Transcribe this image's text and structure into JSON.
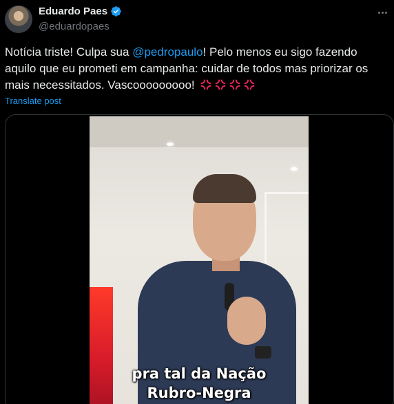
{
  "author": {
    "display_name": "Eduardo Paes",
    "handle": "@eduardopaes",
    "verified": true
  },
  "tweet": {
    "text_before_mention": "Notícia triste!  Culpa sua ",
    "mention": "@pedropaulo",
    "text_after_mention": "!  Pelo menos eu sigo fazendo aquilo que eu prometi em campanha: cuidar de todos mas priorizar os mais necessitados. Vascooooooooo! ",
    "emojis": [
      "anger-symbol",
      "anger-symbol",
      "anger-symbol",
      "anger-symbol"
    ]
  },
  "translate_link": "Translate post",
  "media": {
    "caption_line1": "pra tal da Nação",
    "caption_line2": "Rubro-Negra"
  },
  "colors": {
    "accent": "#1d9bf0",
    "text": "#e7e9ea",
    "muted": "#71767b",
    "background": "#000000",
    "anger_emoji": "#f4245e"
  }
}
